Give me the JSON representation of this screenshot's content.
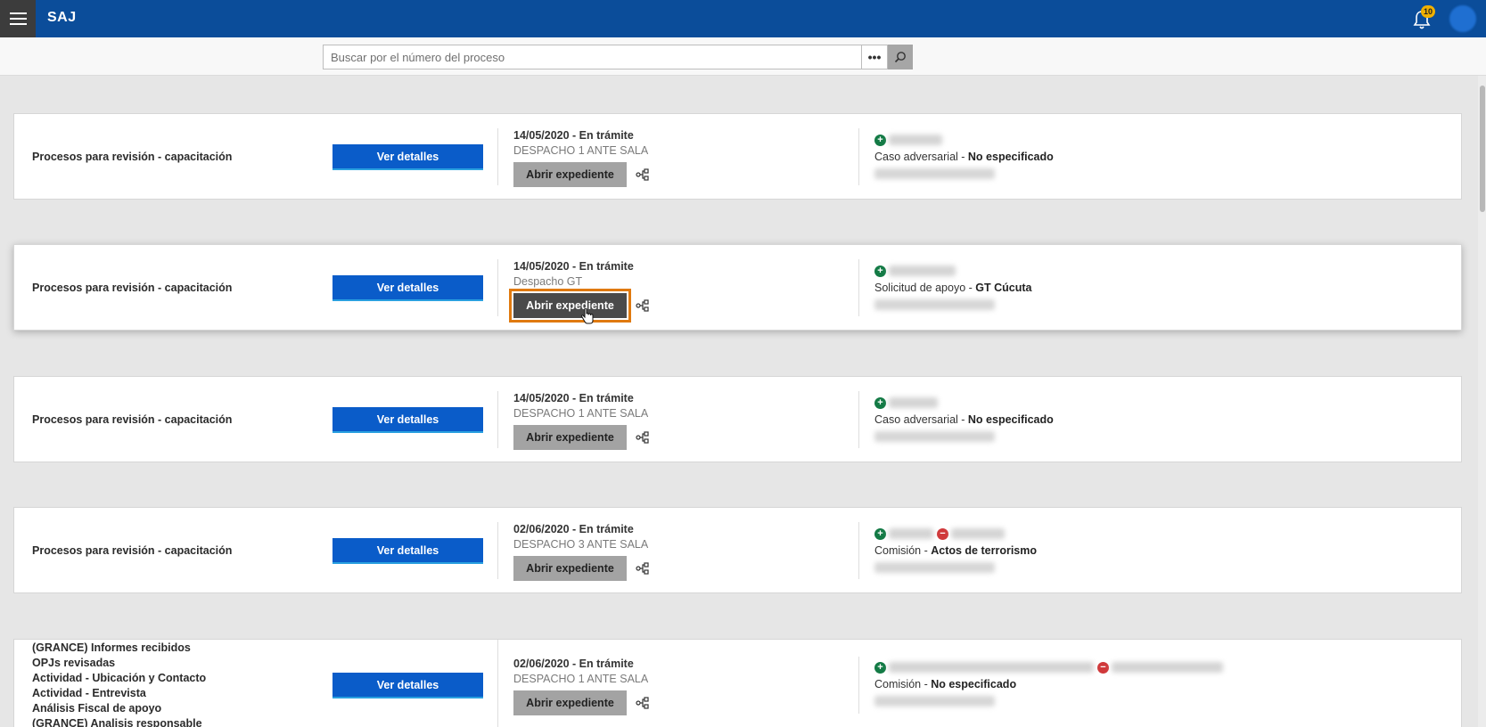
{
  "app": {
    "title": "SAJ",
    "notification_count": "10"
  },
  "search": {
    "placeholder": "Buscar por el número del proceso",
    "more_label": "•••"
  },
  "cards": [
    {
      "title": "Procesos para revisión - capacitación",
      "details_label": "Ver detalles",
      "date_status": "14/05/2020 - En trámite",
      "office": "DESPACHO 1 ANTE SALA",
      "open_label": "Abrir expediente",
      "case_type": "Caso adversarial",
      "case_value": "No especificado"
    },
    {
      "title": "Procesos para revisión - capacitación",
      "details_label": "Ver detalles",
      "date_status": "14/05/2020 - En trámite",
      "office": "Despacho GT",
      "open_label": "Abrir expediente",
      "case_type": "Solicitud de apoyo",
      "case_value": "GT Cúcuta"
    },
    {
      "title": "Procesos para revisión - capacitación",
      "details_label": "Ver detalles",
      "date_status": "14/05/2020 - En trámite",
      "office": "DESPACHO 1 ANTE SALA",
      "open_label": "Abrir expediente",
      "case_type": "Caso adversarial",
      "case_value": "No especificado"
    },
    {
      "title": "Procesos para revisión - capacitación",
      "details_label": "Ver detalles",
      "date_status": "02/06/2020 - En trámite",
      "office": "DESPACHO 3 ANTE SALA",
      "open_label": "Abrir expediente",
      "case_type": "Comisión",
      "case_value": "Actos de terrorismo"
    },
    {
      "title_lines": [
        "(GRANCE) Informes recibidos",
        "OPJs revisadas",
        "Actividad - Ubicación y Contacto",
        "Actividad - Entrevista",
        "Análisis Fiscal de apoyo",
        "(GRANCE) Analisis responsable"
      ],
      "details_label": "Ver detalles",
      "date_status": "02/06/2020 - En trámite",
      "office": "DESPACHO 1 ANTE SALA",
      "open_label": "Abrir expediente",
      "case_type": "Comisión",
      "case_value": "No especificado"
    }
  ],
  "colors": {
    "topbar": "#0b4d9a",
    "primary_button": "#0a5cc9",
    "secondary_button": "#a3a3a3",
    "highlight_outline": "#e07a10",
    "tag_add": "#137a45",
    "tag_remove": "#d0393b"
  }
}
